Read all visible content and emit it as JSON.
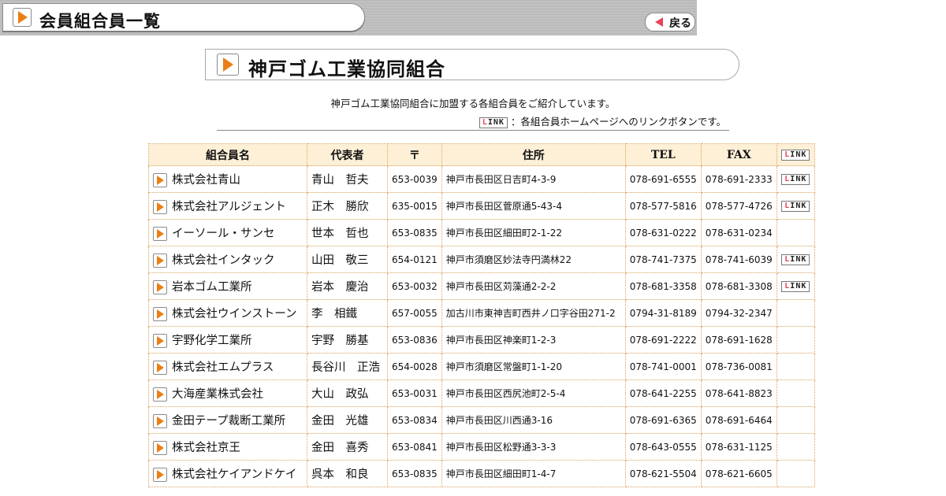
{
  "header": {
    "title": "会員組合員一覧",
    "back_label": "戻る"
  },
  "section": {
    "title": "神戸ゴム工業協同組合"
  },
  "intro": {
    "line1": "神戸ゴム工業協同組合に加盟する各組合員をご紹介しています。",
    "link_badge": "LINK",
    "line2": "：各組合員ホームページへのリンクボタンです。"
  },
  "table": {
    "headers": {
      "name": "組合員名",
      "rep": "代表者",
      "zip": "〒",
      "addr": "住所",
      "tel": "TEL",
      "fax": "FAX",
      "link": "LINK"
    },
    "rows": [
      {
        "name": "株式会社青山",
        "rep": "青山　哲夫",
        "zip": "653-0039",
        "addr": "神戸市長田区日吉町4-3-9",
        "tel": "078-691-6555",
        "fax": "078-691-2333",
        "link": "LINK"
      },
      {
        "name": "株式会社アルジェント",
        "rep": "正木　勝欣",
        "zip": "635-0015",
        "addr": "神戸市長田区菅原通5-43-4",
        "tel": "078-577-5816",
        "fax": "078-577-4726",
        "link": "LINK"
      },
      {
        "name": "イーソール・サンセ",
        "rep": "世本　哲也",
        "zip": "653-0835",
        "addr": "神戸市長田区細田町2-1-22",
        "tel": "078-631-0222",
        "fax": "078-631-0234",
        "link": ""
      },
      {
        "name": "株式会社インタック",
        "rep": "山田　敬三",
        "zip": "654-0121",
        "addr": "神戸市須磨区妙法寺円満林22",
        "tel": "078-741-7375",
        "fax": "078-741-6039",
        "link": "LINK"
      },
      {
        "name": "岩本ゴム工業所",
        "rep": "岩本　慶治",
        "zip": "653-0032",
        "addr": "神戸市長田区苅藻通2-2-2",
        "tel": "078-681-3358",
        "fax": "078-681-3308",
        "link": "LINK"
      },
      {
        "name": "株式会社ウインストーン",
        "rep": "李　相鐵",
        "zip": "657-0055",
        "addr": "加古川市東神吉町西井ノ口字谷田271-2",
        "tel": "0794-31-8189",
        "fax": "0794-32-2347",
        "link": ""
      },
      {
        "name": "宇野化学工業所",
        "rep": "宇野　勝基",
        "zip": "653-0836",
        "addr": "神戸市長田区神楽町1-2-3",
        "tel": "078-691-2222",
        "fax": "078-691-1628",
        "link": ""
      },
      {
        "name": "株式会社エムプラス",
        "rep": "長谷川　正浩",
        "zip": "654-0028",
        "addr": "神戸市須磨区常盤町1-1-20",
        "tel": "078-741-0001",
        "fax": "078-736-0081",
        "link": ""
      },
      {
        "name": "大海産業株式会社",
        "rep": "大山　政弘",
        "zip": "653-0031",
        "addr": "神戸市長田区西尻池町2-5-4",
        "tel": "078-641-2255",
        "fax": "078-641-8823",
        "link": ""
      },
      {
        "name": "金田テープ裁断工業所",
        "rep": "金田　光雄",
        "zip": "653-0834",
        "addr": "神戸市長田区川西通3-16",
        "tel": "078-691-6365",
        "fax": "078-691-6464",
        "link": ""
      },
      {
        "name": "株式会社京王",
        "rep": "金田　喜秀",
        "zip": "653-0841",
        "addr": "神戸市長田区松野通3-3-3",
        "tel": "078-643-0555",
        "fax": "078-631-1125",
        "link": ""
      },
      {
        "name": "株式会社ケイアンドケイ",
        "rep": "呉本　和良",
        "zip": "653-0835",
        "addr": "神戸市長田区細田町1-4-7",
        "tel": "078-621-5504",
        "fax": "078-621-6605",
        "link": ""
      }
    ]
  },
  "colors": {
    "accent_orange": "#ea7f16",
    "header_fill": "#fdf0d7",
    "border_orange": "#d9a15b",
    "link_red": "#e8455a"
  }
}
